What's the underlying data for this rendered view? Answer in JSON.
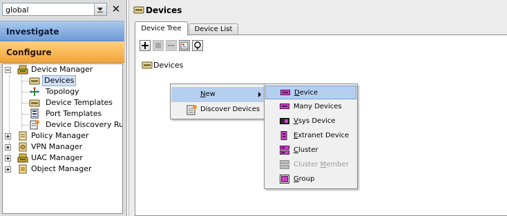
{
  "scope": {
    "value": "global"
  },
  "nav": {
    "investigate": "Investigate",
    "configure": "Configure"
  },
  "tree": {
    "device_manager": "Device Manager",
    "devices": "Devices",
    "topology": "Topology",
    "device_templates": "Device Templates",
    "port_templates": "Port Templates",
    "device_discovery_rules": "Device Discovery Rules",
    "policy_manager": "Policy Manager",
    "vpn_manager": "VPN Manager",
    "uac_manager": "UAC Manager",
    "object_manager": "Object Manager"
  },
  "header": {
    "title": "Devices"
  },
  "tabs": {
    "device_tree": "Device Tree",
    "device_list": "Device List"
  },
  "content": {
    "root_label": "Devices"
  },
  "context_menu": {
    "new": {
      "u": "N",
      "rest": "ew"
    },
    "discover_devices": "Discover Devices"
  },
  "new_submenu": {
    "device": {
      "u": "D",
      "rest": "evice"
    },
    "many_devices": "Many Devices",
    "vsys_device": {
      "u": "V",
      "rest": "sys Device"
    },
    "extranet_device": {
      "u": "E",
      "rest": "xtranet Device"
    },
    "cluster": {
      "u": "C",
      "rest": "luster"
    },
    "cluster_member": {
      "pre": "Cluster ",
      "u": "M",
      "rest": "ember"
    },
    "group": {
      "u": "G",
      "rest": "roup"
    }
  },
  "colors": {
    "device_magenta": "#d040c8",
    "investigate_blue": "#6f9bd6",
    "configure_orange": "#f2a33a",
    "menu_highlight": "#b5cff0"
  }
}
